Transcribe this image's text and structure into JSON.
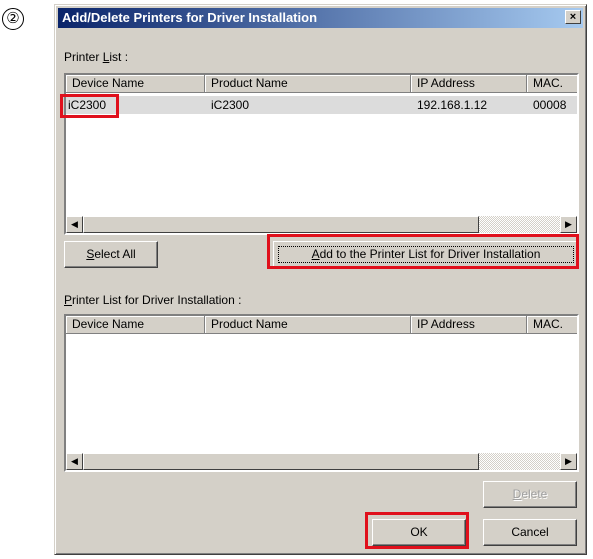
{
  "step_marker": "②",
  "dialog": {
    "title": "Add/Delete Printers for Driver Installation",
    "close_glyph": "×"
  },
  "printer_list": {
    "label_pre": "Printer ",
    "label_key": "L",
    "label_post": "ist :",
    "columns": [
      "Device Name",
      "Product Name",
      "IP Address",
      "MAC."
    ],
    "rows": [
      {
        "device": "iC2300",
        "product": "iC2300",
        "ip": "192.168.1.12",
        "mac": "00008"
      }
    ]
  },
  "buttons": {
    "select_all_key": "S",
    "select_all_rest": "elect All",
    "add_key": "A",
    "add_rest": "dd to the Printer List for Driver Installation",
    "delete_key": "D",
    "delete_rest": "elete",
    "ok": "OK",
    "cancel": "Cancel"
  },
  "install_list": {
    "label_key": "P",
    "label_rest": "rinter List for Driver Installation :",
    "columns": [
      "Device Name",
      "Product Name",
      "IP Address",
      "MAC."
    ]
  },
  "colors": {
    "highlight_box": "#e0101c",
    "titlebar_start": "#0a246a",
    "titlebar_end": "#a6caf0"
  }
}
